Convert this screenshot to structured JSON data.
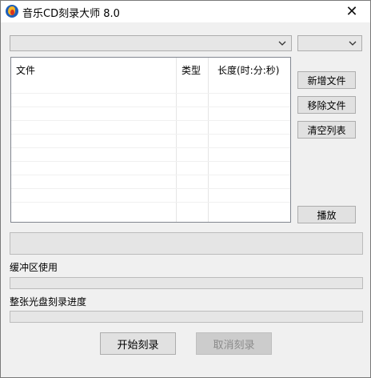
{
  "window": {
    "title": "音乐CD刻录大师 8.0",
    "close_glyph": "✕",
    "app_icon": "music-cd-app-icon"
  },
  "drive_select": {
    "value": ""
  },
  "speed_select": {
    "value": ""
  },
  "file_list": {
    "columns": [
      "文件",
      "类型",
      "长度(时:分:秒)"
    ],
    "rows": []
  },
  "side_buttons": {
    "add_file": "新增文件",
    "remove_file": "移除文件",
    "clear_list": "清空列表",
    "play": "播放"
  },
  "buffer": {
    "label": "缓冲区使用",
    "progress": 0
  },
  "disc": {
    "label": "整张光盘刻录进度",
    "progress": 0
  },
  "actions": {
    "start": "开始刻录",
    "cancel": "取消刻录",
    "cancel_enabled": false
  },
  "colors": {
    "progress_fill": "#06b025"
  }
}
